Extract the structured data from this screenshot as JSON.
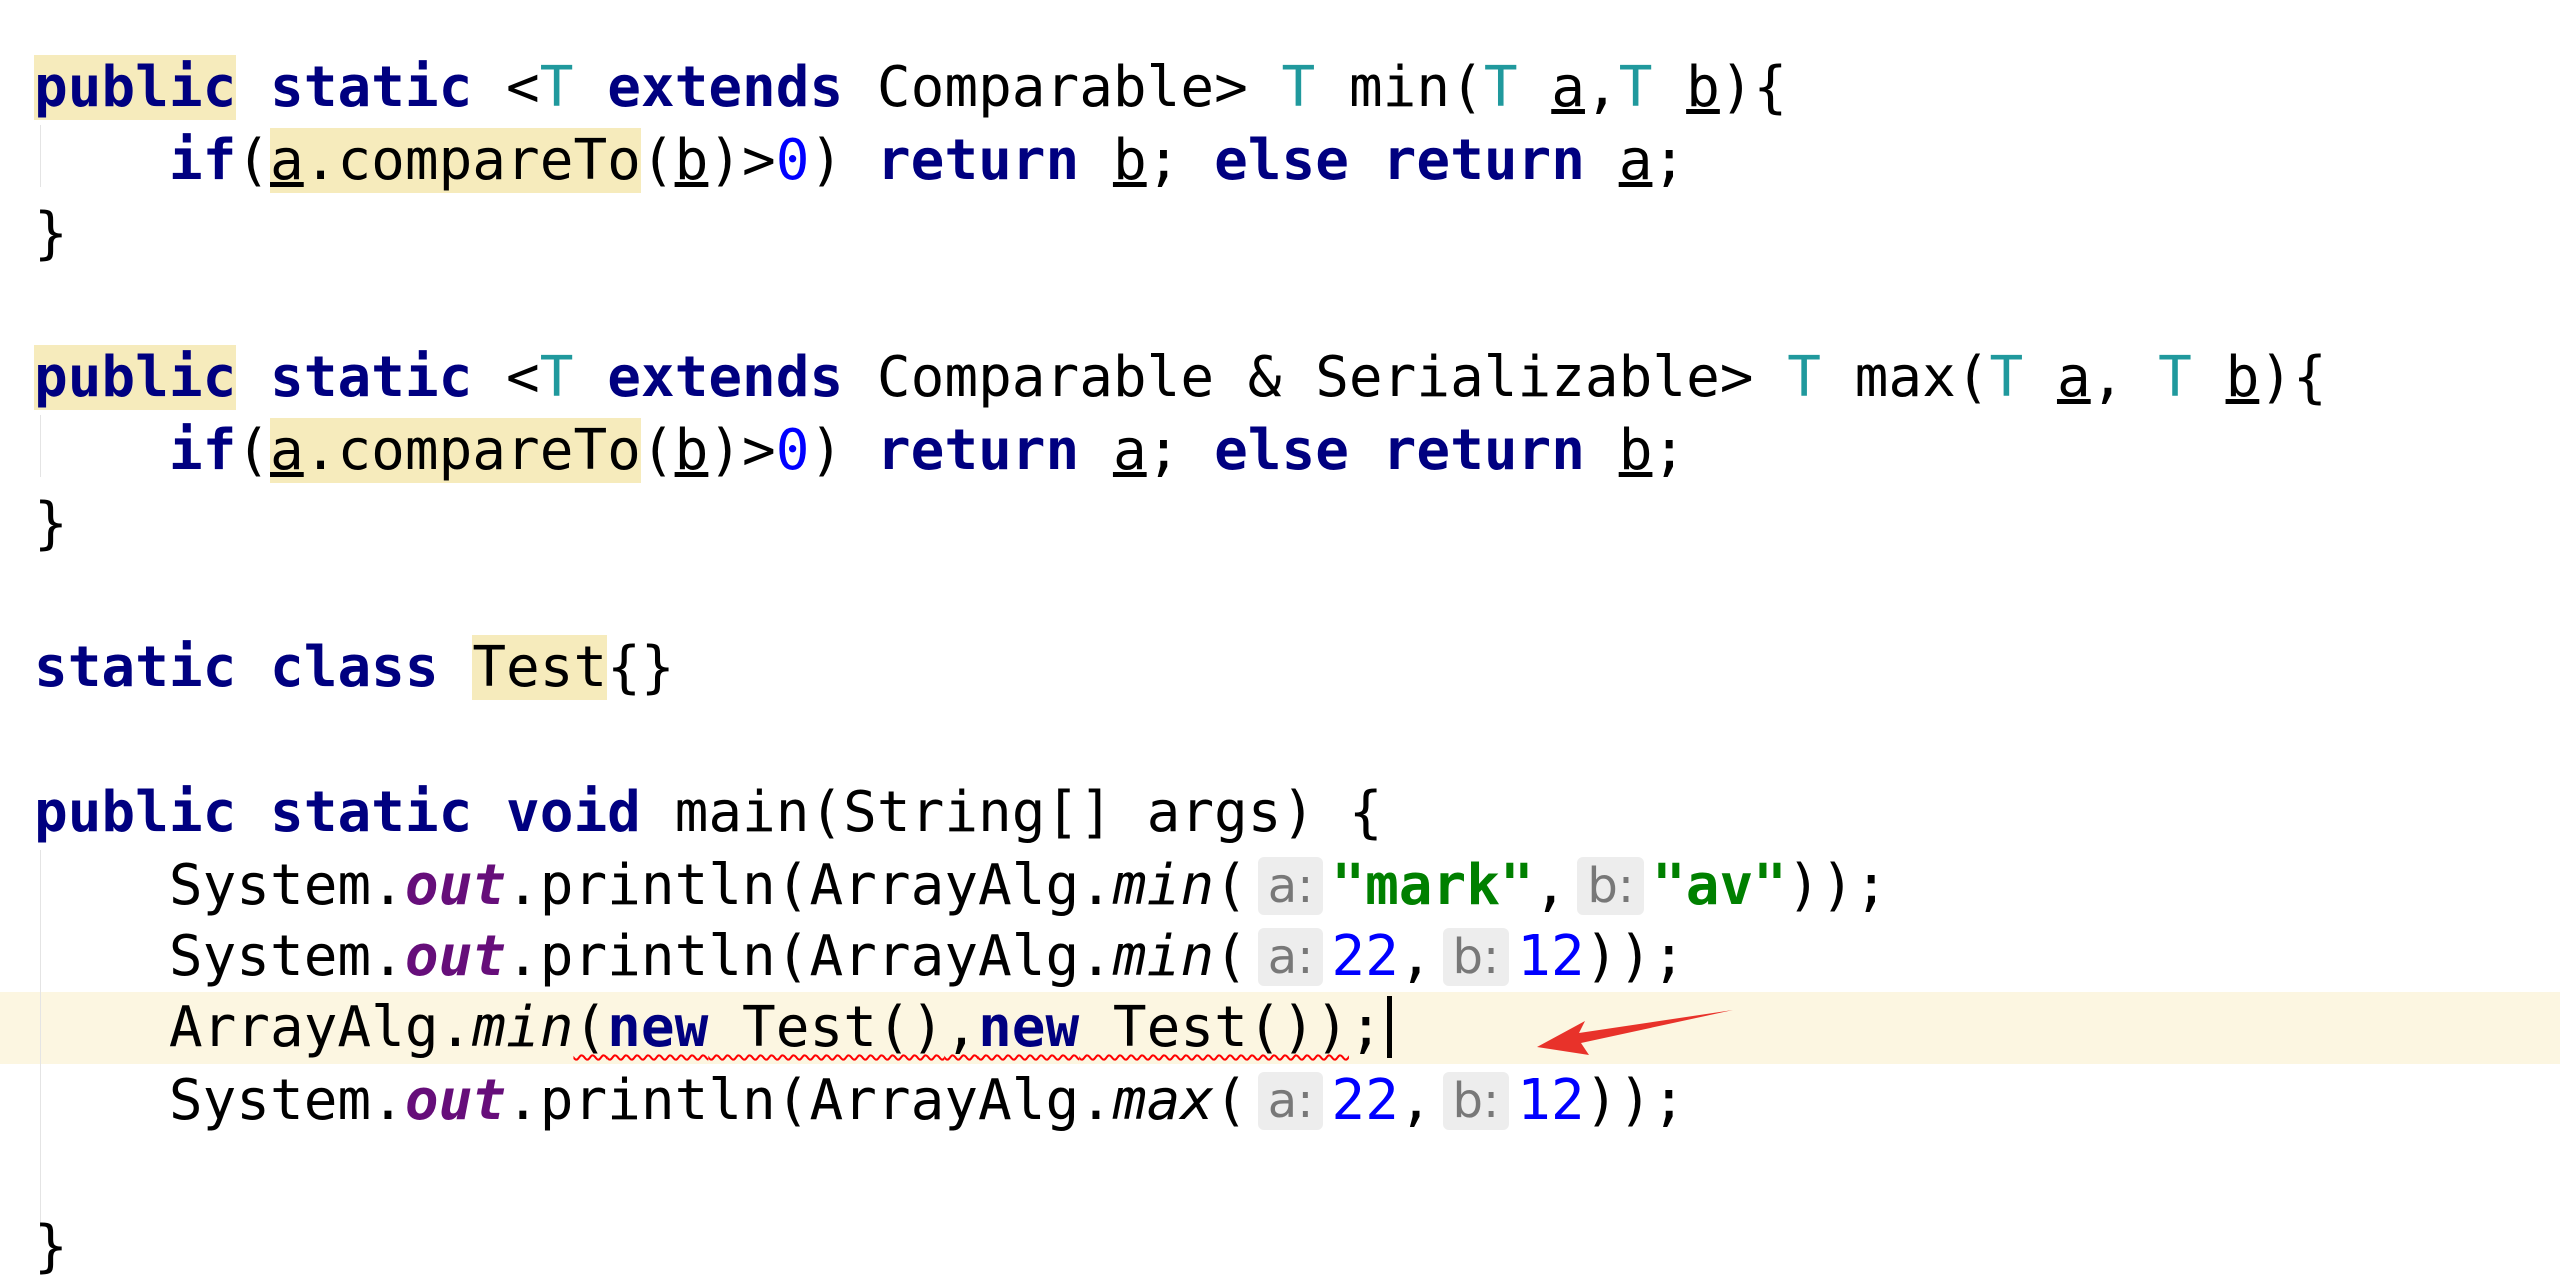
{
  "code": {
    "min_method": {
      "signature": {
        "public": "public",
        "static": "static",
        "lt": "<",
        "T1": "T",
        "extends": "extends",
        "bound": "Comparable>",
        "ret_T": "T",
        "name": "min(",
        "pT_a": "T",
        "a": "a",
        "comma": ",",
        "pT_b": "T",
        "b": "b",
        "close": "){"
      },
      "body": {
        "if": "if",
        "paren_open": "(",
        "a": "a",
        "compare": ".compareTo",
        "paren_b_open": "(",
        "b": "b",
        "cmp": ")>",
        "zero": "0",
        "paren_close": ")",
        "return1": "return",
        "ret_var1": "b",
        "semi_else": "; ",
        "else": "else",
        "return2": "return",
        "ret_var2": "a",
        "semi": ";"
      },
      "close_brace": "}"
    },
    "max_method": {
      "signature": {
        "public": "public",
        "static": "static",
        "lt": "<",
        "T1": "T",
        "extends": "extends",
        "bound": "Comparable & Serializable>",
        "ret_T": "T",
        "name": "max(",
        "pT_a": "T",
        "a": "a",
        "comma": ", ",
        "pT_b": "T",
        "b": "b",
        "close": "){"
      },
      "body": {
        "if": "if",
        "paren_open": "(",
        "a": "a",
        "compare": ".compareTo",
        "paren_b_open": "(",
        "b": "b",
        "cmp": ")>",
        "zero": "0",
        "paren_close": ")",
        "return1": "return",
        "ret_var1": "a",
        "semi_else": "; ",
        "else": "else",
        "return2": "return",
        "ret_var2": "b",
        "semi": ";"
      },
      "close_brace": "}"
    },
    "test_class": {
      "static": "static",
      "class": "class",
      "name": "Test",
      "braces": "{}"
    },
    "main_method": {
      "public": "public",
      "static": "static",
      "void": "void",
      "rest": "main(String[] args) {",
      "close_brace": "}"
    },
    "statement1": {
      "system": "System.",
      "out": "out",
      "println": ".println(ArrayAlg.",
      "method": "min",
      "open": "(",
      "hint_a": "a:",
      "arg_a": "\"mark\"",
      "comma": ",",
      "hint_b": "b:",
      "arg_b": "\"av\"",
      "close": "));"
    },
    "statement2": {
      "system": "System.",
      "out": "out",
      "println": ".println(ArrayAlg.",
      "method": "min",
      "open": "(",
      "hint_a": "a:",
      "arg_a": "22",
      "comma": ",",
      "hint_b": "b:",
      "arg_b": "12",
      "close": "));"
    },
    "statement3": {
      "prefix": "ArrayAlg.",
      "method": "min",
      "open": "(",
      "new1": "new",
      "test1": " Test()",
      "comma": ",",
      "new2": "new",
      "test2": " Test())",
      "semi": ";"
    },
    "statement4": {
      "system": "System.",
      "out": "out",
      "println": ".println(ArrayAlg.",
      "method": "max",
      "open": "(",
      "hint_a": "a:",
      "arg_a": "22",
      "comma": ",",
      "hint_b": "b:",
      "arg_b": "12",
      "close": "));"
    }
  },
  "annotation": {
    "arrow_color": "#e8322a"
  },
  "colors": {
    "keyword": "#000080",
    "type_param": "#20999d",
    "number": "#0000ff",
    "string": "#008000",
    "static_field": "#660e7a",
    "identifier_highlight": "#f6ebbc",
    "current_line": "#fcf6e1",
    "error_underline": "#ff0000",
    "hint_background": "#ededed"
  }
}
